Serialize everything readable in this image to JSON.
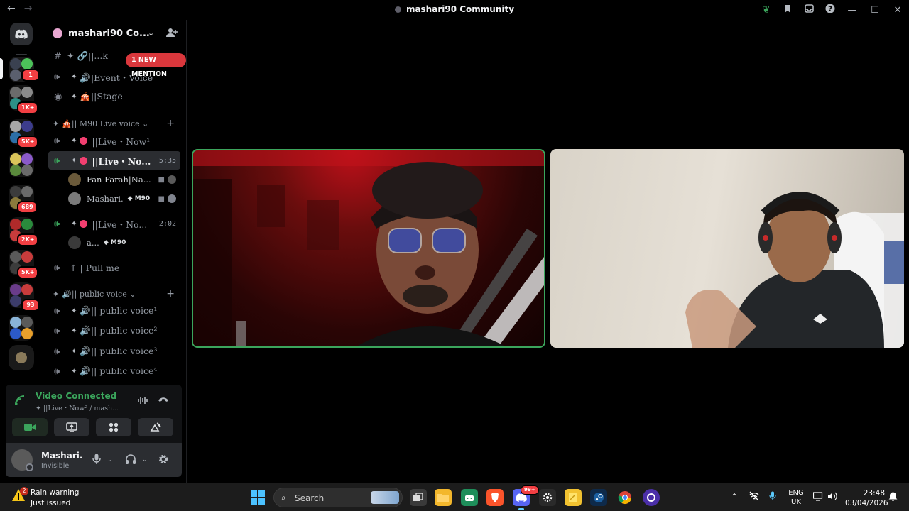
{
  "window": {
    "title": "mashari90 Community",
    "back_glyph": "←",
    "forward_glyph": "→"
  },
  "server": {
    "name": "mashari90 Co...",
    "mention_banner": "1 NEW MENTION"
  },
  "rail_badges": [
    "1",
    "1K+",
    "5K+",
    "689",
    "2K+",
    "5K+",
    "93"
  ],
  "channels": [
    {
      "icon": "hash-icon",
      "label": "✦ 🔗||...k",
      "kind": "text"
    },
    {
      "icon": "speaker-icon",
      "label": "🔊|Event・Voice",
      "kind": "voice"
    },
    {
      "icon": "stage-icon",
      "label": "🎪||Stage",
      "kind": "stage"
    }
  ],
  "category_live": {
    "label": "🎪|| M90 Live voice ⌄"
  },
  "live_channels": [
    {
      "label": "||Live・Now¹",
      "time": ""
    },
    {
      "label": "||Live・No...",
      "time": "5:35",
      "active": true,
      "users": [
        {
          "name": "Fan Farah|Na...",
          "tag": ""
        },
        {
          "name": "Mashari.",
          "tag": "M90"
        }
      ]
    },
    {
      "label": "||Live・No...",
      "time": "2:02",
      "users": [
        {
          "name": "a...",
          "tag": "M90"
        }
      ]
    }
  ],
  "pull_me": {
    "label": "↑ | Pull me"
  },
  "category_public": {
    "label": "🔊|| public voice ⌄"
  },
  "public_channels": [
    {
      "label": "🔊|| public voice¹"
    },
    {
      "label": "🔊|| public voice²"
    },
    {
      "label": "🔊|| public voice³"
    },
    {
      "label": "🔊|| public voice⁴"
    }
  ],
  "voice_panel": {
    "title": "Video Connected",
    "subtitle": "✦ ||Live・Now² / mash..."
  },
  "user_panel": {
    "name": "Mashari.",
    "status": "Invisible"
  },
  "taskbar": {
    "weather_title": "Rain warning",
    "weather_sub": "Just issued",
    "weather_badge": "2",
    "search_placeholder": "Search",
    "discord_badge": "99+",
    "lang_top": "ENG",
    "lang_bottom": "UK",
    "time": "23:48",
    "date": "03/04/2026"
  },
  "colors": {
    "accent_green": "#3ba55c",
    "badge_red": "#f23f43",
    "live_dot": "#f23f70"
  }
}
